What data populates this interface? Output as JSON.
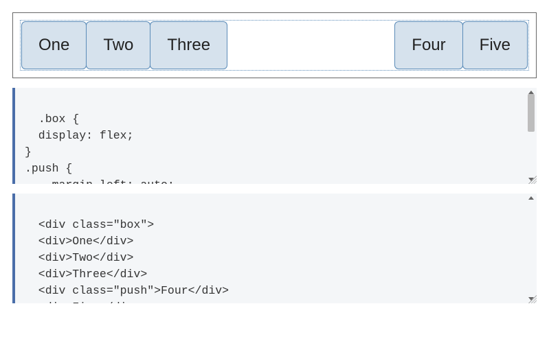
{
  "example": {
    "items": [
      "One",
      "Two",
      "Three",
      "Four",
      "Five"
    ],
    "pushIndex": 3
  },
  "code": {
    "css": ".box {\n  display: flex;\n}\n.push {\n    margin-left: auto;\n}",
    "html": "<div class=\"box\">\n  <div>One</div>\n  <div>Two</div>\n  <div>Three</div>\n  <div class=\"push\">Four</div>\n  <div>Five</div>\n</div>"
  }
}
